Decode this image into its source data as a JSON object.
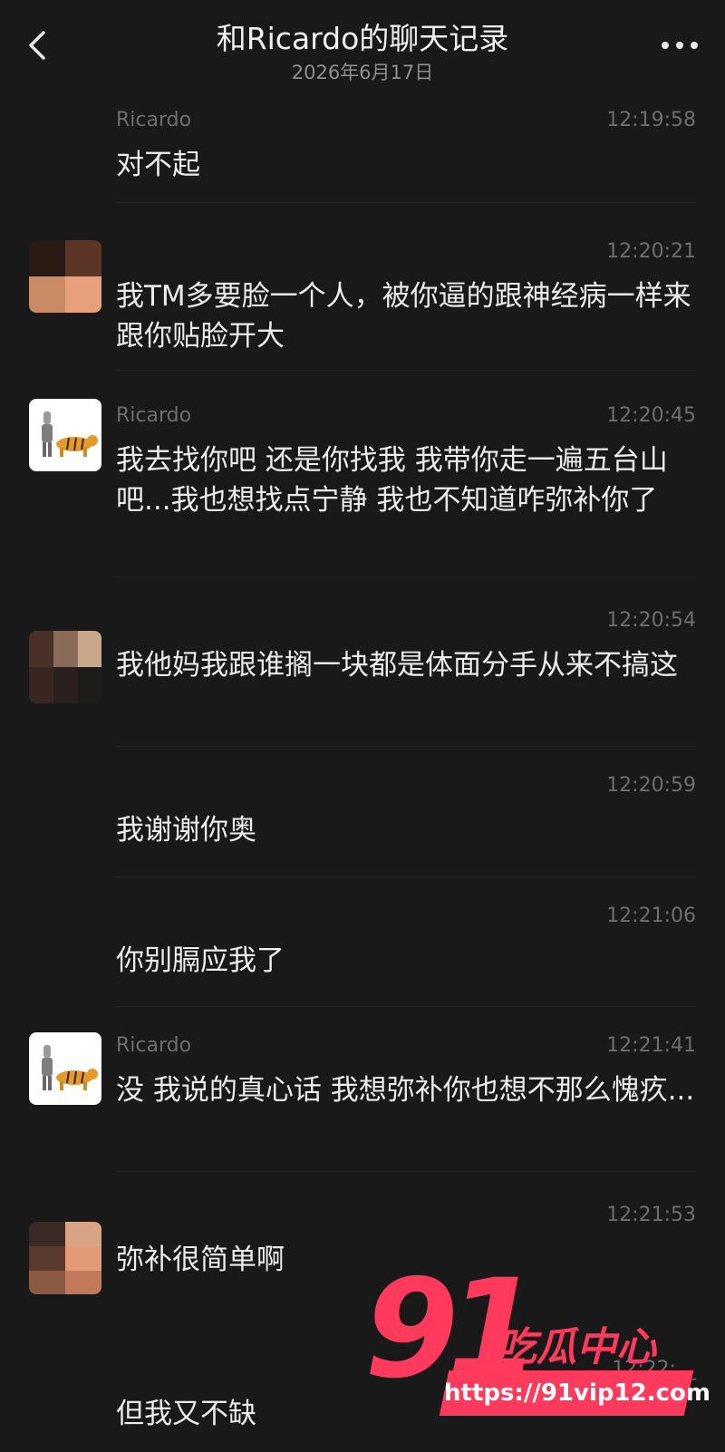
{
  "header": {
    "title": "和Ricardo的聊天记录",
    "subtitle": "2026年6月17日",
    "back_icon": "chevron-left-icon",
    "more_icon": "more-dots-icon"
  },
  "messages": [
    {
      "name": "Ricardo",
      "time": "12:19:58",
      "text": "对不起"
    },
    {
      "name": "",
      "time": "12:20:21",
      "text": "我TM多要脸一个人，被你逼的跟神经病一样来跟你贴脸开大"
    },
    {
      "name": "Ricardo",
      "time": "12:20:45",
      "text": "我去找你吧 还是你找我 我带你走一遍五台山吧...我也想找点宁静 我也不知道咋弥补你了"
    },
    {
      "name": "",
      "time": "12:20:54",
      "text": "我他妈我跟谁搁一块都是体面分手从来不搞这"
    },
    {
      "name": "",
      "time": "12:20:59",
      "text": "我谢谢你奥"
    },
    {
      "name": "",
      "time": "12:21:06",
      "text": "你别膈应我了"
    },
    {
      "name": "Ricardo",
      "time": "12:21:41",
      "text": "没 我说的真心话 我想弥补你也想不那么愧疚..."
    },
    {
      "name": "",
      "time": "12:21:53",
      "text": "弥补很简单啊"
    },
    {
      "name": "",
      "time": "12:22:__",
      "text": "但我又不缺"
    }
  ],
  "watermark": {
    "number": "91",
    "text": "吃瓜中心",
    "url": "https://91vip12.com",
    "color": "#ff3a5d"
  }
}
